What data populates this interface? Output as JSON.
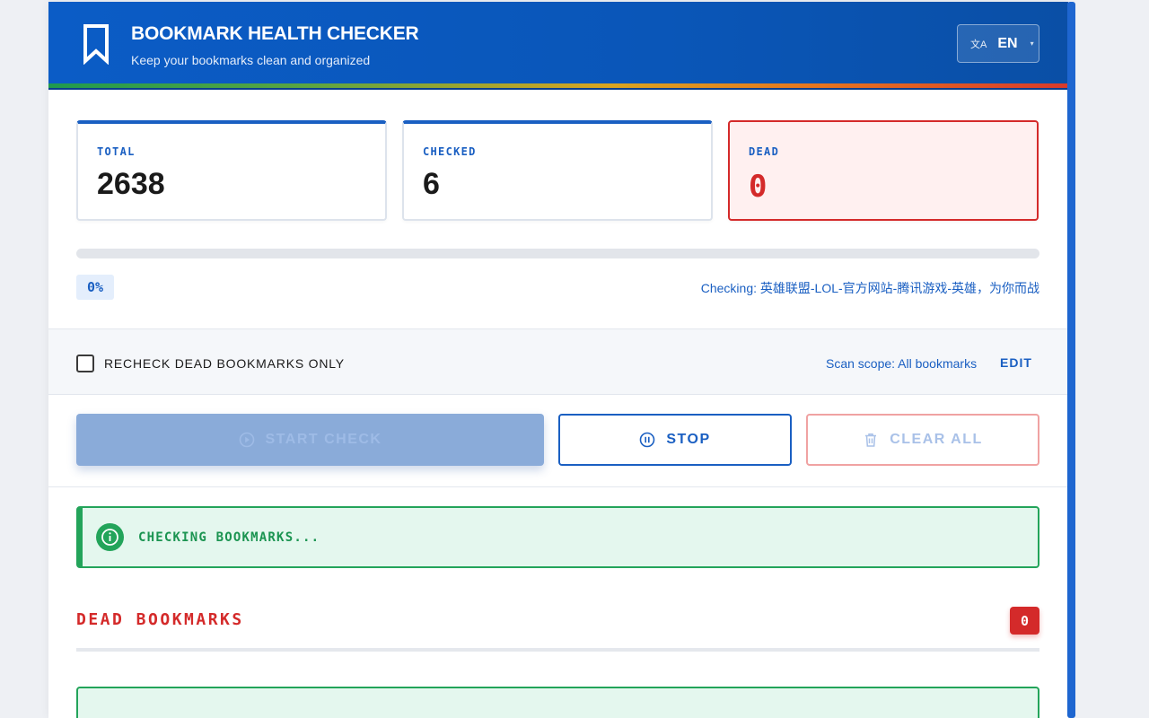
{
  "header": {
    "title": "BOOKMARK HEALTH CHECKER",
    "subtitle": "Keep your bookmarks clean and organized",
    "logo_icon": "bookmark-icon",
    "language": {
      "icon": "translate-icon",
      "label": "EN"
    }
  },
  "stats": {
    "total": {
      "label": "TOTAL",
      "value": "2638"
    },
    "checked": {
      "label": "CHECKED",
      "value": "6"
    },
    "dead": {
      "label": "DEAD",
      "value": "0"
    }
  },
  "progress": {
    "value_percent": 0,
    "percent_label": "0%",
    "checking_text": "Checking: 英雄联盟-LOL-官方网站-腾讯游戏-英雄，为你而战"
  },
  "options": {
    "recheck_label": "RECHECK DEAD BOOKMARKS ONLY",
    "recheck_checked": false,
    "scope_text": "Scan scope: All bookmarks",
    "edit_label": "EDIT"
  },
  "actions": {
    "start_label": "START CHECK",
    "stop_label": "STOP",
    "clear_label": "CLEAR ALL"
  },
  "status": {
    "icon": "info-icon",
    "message": "CHECKING BOOKMARKS..."
  },
  "dead_section": {
    "title": "DEAD  BOOKMARKS",
    "count": "0"
  },
  "colors": {
    "primary": "#1a5fc2",
    "danger": "#d42a2a",
    "success": "#23a45a"
  }
}
